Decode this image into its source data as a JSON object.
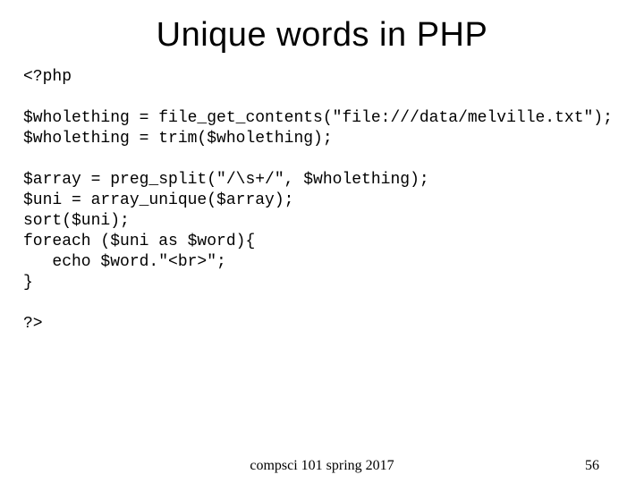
{
  "title": "Unique words in PHP",
  "code": {
    "l01": "<?php",
    "l02": "",
    "l03": "$wholething = file_get_contents(\"file:///data/melville.txt\");",
    "l04": "$wholething = trim($wholething);",
    "l05": "",
    "l06": "$array = preg_split(\"/\\s+/\", $wholething);",
    "l07": "$uni = array_unique($array);",
    "l08": "sort($uni);",
    "l09": "foreach ($uni as $word){",
    "l10": "   echo $word.\"<br>\";",
    "l11": "}",
    "l12": "",
    "l13": "?>"
  },
  "footer": {
    "course": "compsci 101 spring 2017",
    "page": "56"
  }
}
